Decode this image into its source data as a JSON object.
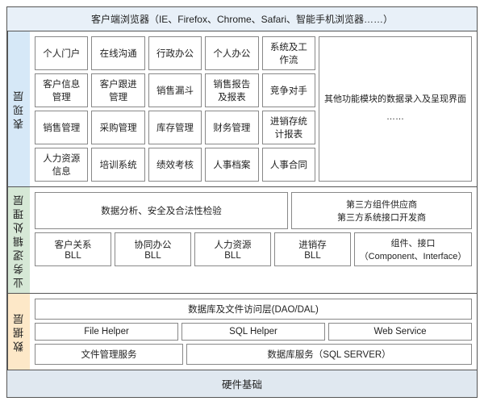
{
  "browser_bar": "客户端浏览器（IE、Firefox、Chrome、Safari、智能手机浏览器……）",
  "layers": {
    "presentation": {
      "label": "表现层",
      "row1": [
        "个人门户",
        "在线沟通",
        "行政办公",
        "个人办公",
        "系统及工作流"
      ],
      "row2": [
        "客户信息管理",
        "客户跟进管理",
        "销售漏斗",
        "销售报告及报表",
        "竞争对手"
      ],
      "row3": [
        "销售管理",
        "采购管理",
        "库存管理",
        "财务管理",
        "进销存统计报表"
      ],
      "row4": [
        "人力资源信息",
        "培训系统",
        "绩效考核",
        "人事档案",
        "人事合同"
      ],
      "side_label": "其他功能模块的数据录入及呈现界面",
      "side_extra": "……"
    },
    "business": {
      "label": "业务逻辑处理层",
      "top_left": "数据分析、安全及合法性检验",
      "top_right": "第三方组件供应商\n第三方系统接口开发商",
      "bll_items": [
        {
          "name": "客户关系",
          "sub": "BLL"
        },
        {
          "name": "协同办公",
          "sub": "BLL"
        },
        {
          "name": "人力资源",
          "sub": "BLL"
        },
        {
          "name": "进销存",
          "sub": "BLL"
        }
      ],
      "component": "组件、接口\n（Component、Interface）"
    },
    "data": {
      "label": "数据层",
      "dao_label": "数据库及文件访问层(DAO/DAL)",
      "helpers": [
        "File Helper",
        "SQL Helper",
        "Web Service"
      ],
      "services": [
        "文件管理服务",
        "数据库服务（SQL SERVER）"
      ]
    }
  },
  "hardware": "硬件基础"
}
